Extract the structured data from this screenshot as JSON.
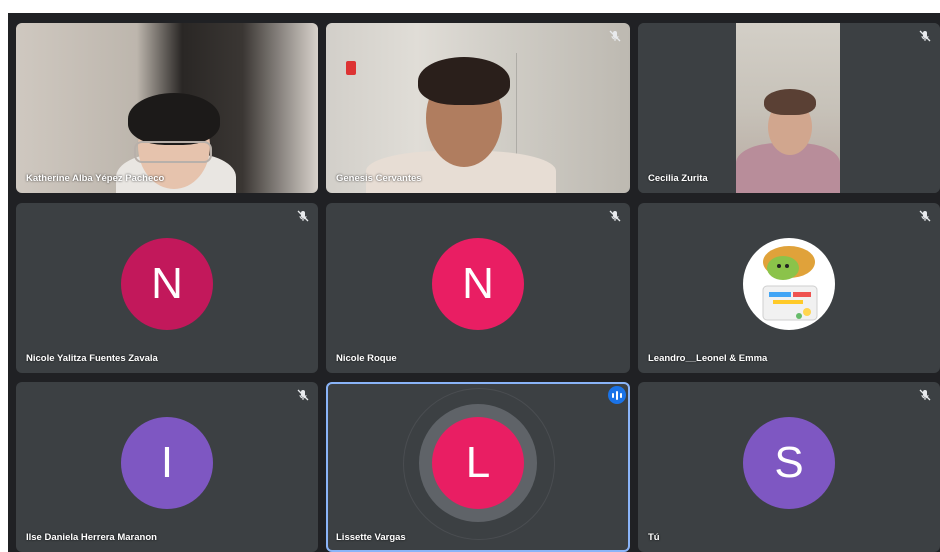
{
  "participants": [
    {
      "name": "Katherine Alba Yépez Pacheco",
      "type": "video",
      "muted": false
    },
    {
      "name": "Genesis Cervantes",
      "type": "video",
      "muted": true
    },
    {
      "name": "Cecilia Zurita",
      "type": "video",
      "muted": true
    },
    {
      "name": "Nicole Yalitza Fuentes Zavala",
      "type": "avatar",
      "initial": "N",
      "color": "#c2185b",
      "muted": true
    },
    {
      "name": "Nicole Roque",
      "type": "avatar",
      "initial": "N",
      "color": "#e91e63",
      "muted": true
    },
    {
      "name": "Leandro__Leonel & Emma",
      "type": "image",
      "muted": true
    },
    {
      "name": "Ilse Daniela Herrera Maranon",
      "type": "avatar",
      "initial": "I",
      "color": "#7e57c2",
      "muted": true
    },
    {
      "name": "Lissette Vargas",
      "type": "avatar",
      "initial": "L",
      "color": "#e91e63",
      "speaking": true
    },
    {
      "name": "Tú",
      "type": "avatar",
      "initial": "S",
      "color": "#7e57c2",
      "muted": true
    }
  ],
  "colors": {
    "tile_bg": "#3c4043",
    "stage_bg": "#202124",
    "active_border": "#8ab4f8",
    "speaking_badge": "#1a73e8"
  },
  "icons": {
    "mute": "mic-off-icon",
    "speaking": "audio-level-icon"
  }
}
